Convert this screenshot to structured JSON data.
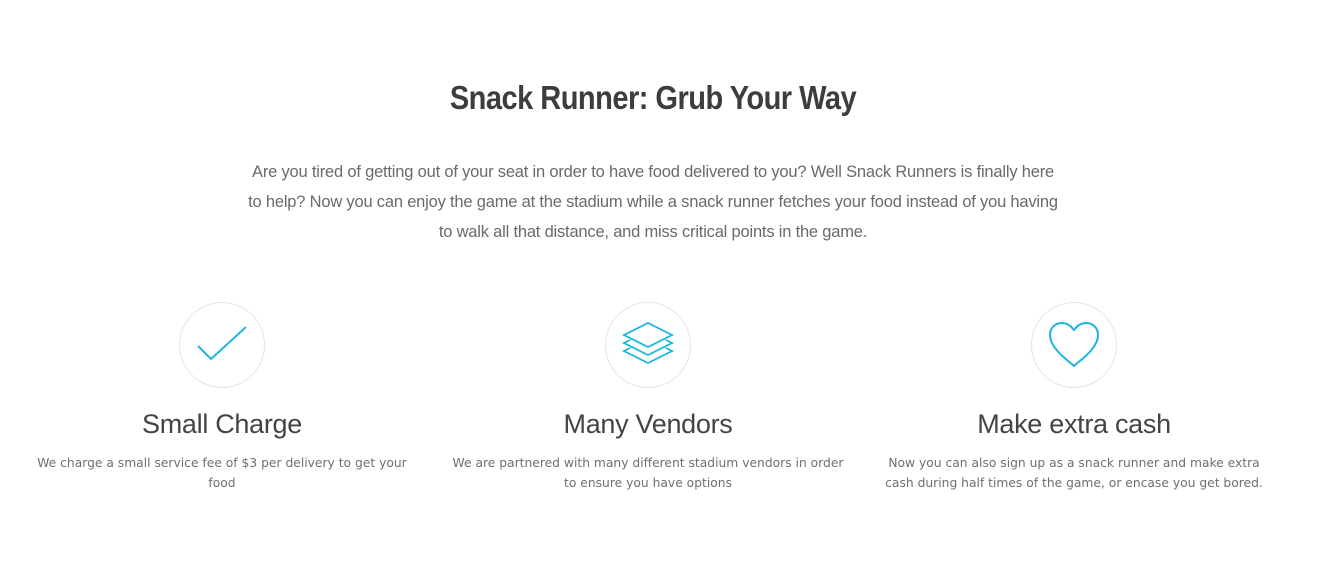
{
  "header": {
    "title": "Snack Runner: Grub Your Way",
    "intro": "Are you tired of getting out of your seat in order to have food delivered to you? Well Snack Runners is finally here to help? Now you can enjoy the game at the stadium while a snack runner fetches your food instead of you having to walk all that distance, and miss critical points in the game."
  },
  "features": [
    {
      "icon": "checkmark-icon",
      "title": "Small Charge",
      "text": "We charge a small service fee of $3 per delivery to get your food"
    },
    {
      "icon": "layers-icon",
      "title": "Many Vendors",
      "text": "We are partnered with many different stadium vendors in order to ensure you have options"
    },
    {
      "icon": "heart-icon",
      "title": "Make extra cash",
      "text": "Now you can also sign up as a snack runner and make extra cash during half times of the game, or encase you get bored."
    }
  ],
  "colors": {
    "accent": "#1fb5e0",
    "heading": "#3d3d3d",
    "body_text": "#6a6a6a",
    "circle_border": "#e4e4e4"
  }
}
